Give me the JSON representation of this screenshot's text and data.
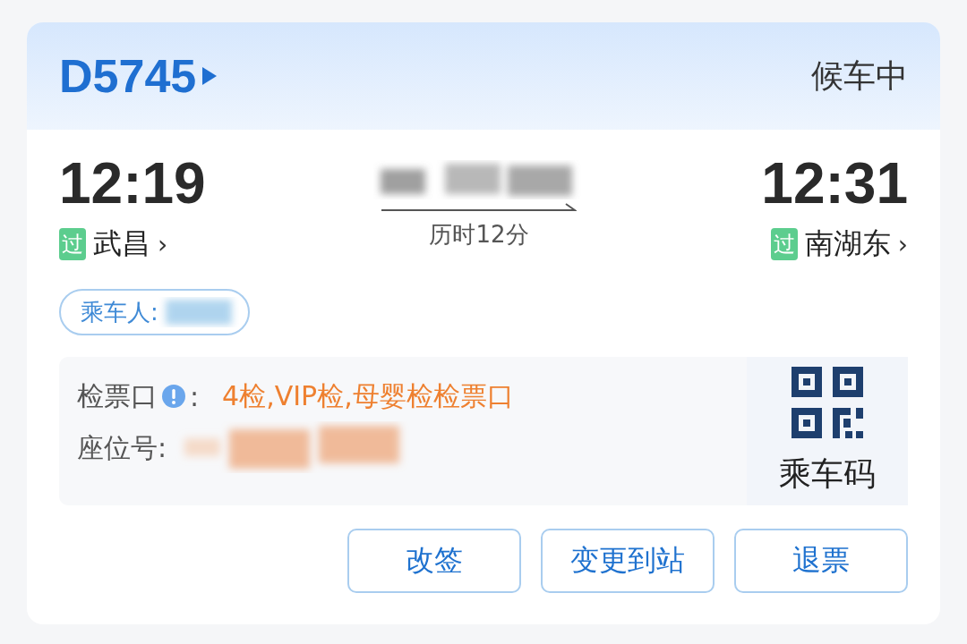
{
  "train": {
    "number": "D5745",
    "status": "候车中"
  },
  "departure": {
    "time": "12:19",
    "tag": "过",
    "station": "武昌",
    "chevron": "›"
  },
  "duration": "历时12分",
  "arrival": {
    "time": "12:31",
    "tag": "过",
    "station": "南湖东",
    "chevron": "›"
  },
  "passenger": {
    "label": "乘车人:"
  },
  "gate": {
    "label": "检票口",
    "colon": ":",
    "value": "4检,VIP检,母婴检检票口"
  },
  "seat": {
    "label": "座位号:"
  },
  "boarding_code": {
    "label": "乘车码"
  },
  "buttons": [
    "改签",
    "变更到站",
    "退票"
  ]
}
